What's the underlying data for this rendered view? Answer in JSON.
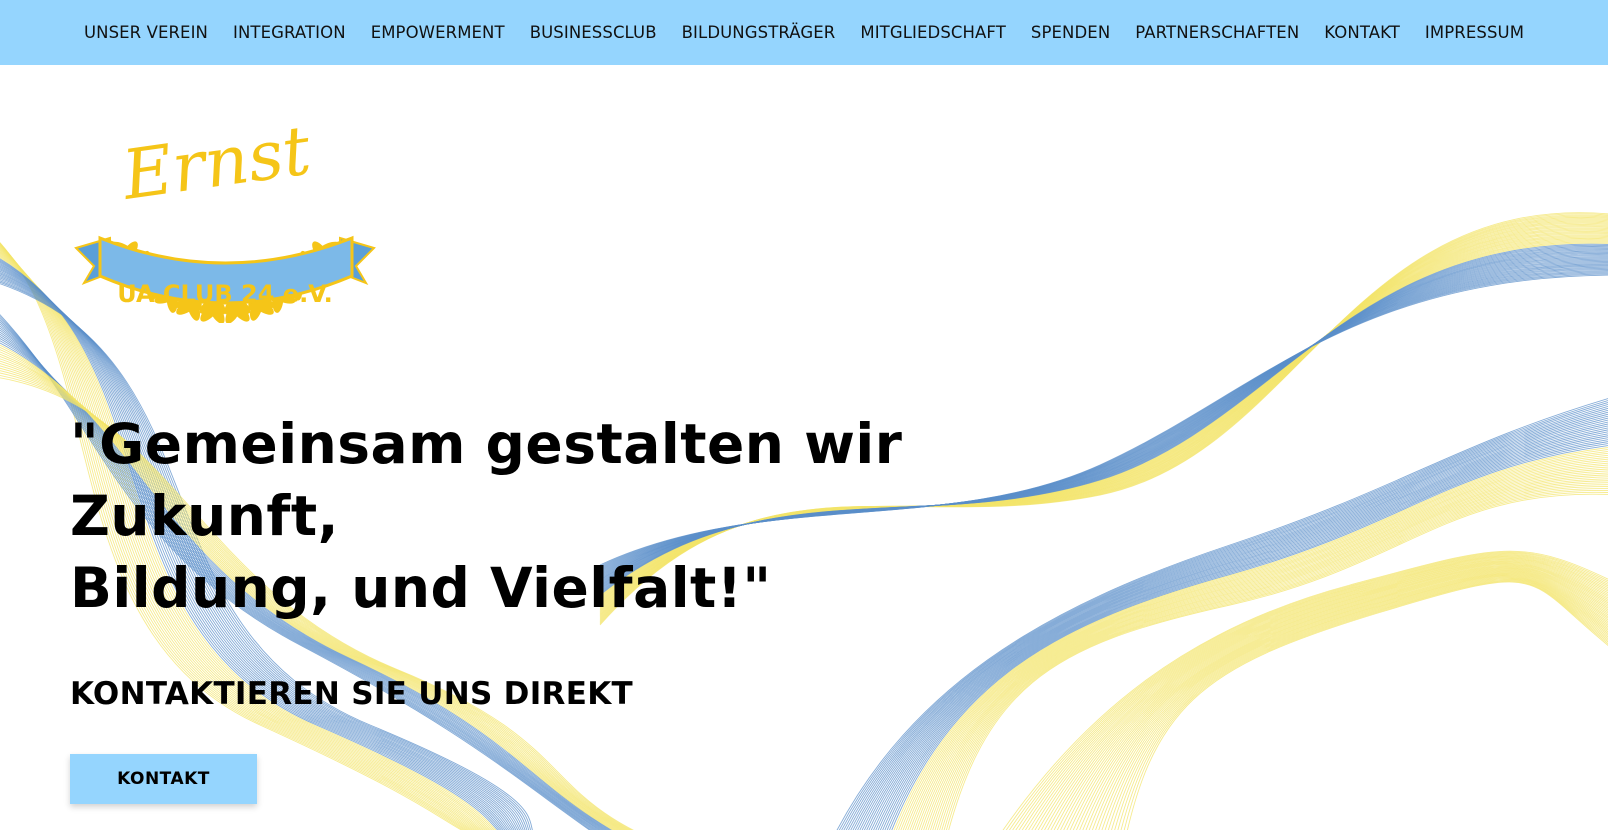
{
  "nav": {
    "items": [
      {
        "label": "UNSER VEREIN"
      },
      {
        "label": "INTEGRATION"
      },
      {
        "label": "EMPOWERMENT"
      },
      {
        "label": "BUSINESSCLUB"
      },
      {
        "label": "BILDUNGSTRÄGER"
      },
      {
        "label": "MITGLIEDSCHAFT"
      },
      {
        "label": "SPENDEN"
      },
      {
        "label": "PARTNERSCHAFTEN"
      },
      {
        "label": "KONTAKT"
      },
      {
        "label": "IMPRESSUM"
      }
    ]
  },
  "logo": {
    "script_text": "Ernst",
    "ribbon_text": "UA CLUB 24 e.V."
  },
  "hero": {
    "headline_line1": "\"Gemeinsam gestalten wir Zukunft,",
    "headline_line2": "Bildung, und Vielfalt!\"",
    "subhead": "KONTAKTIEREN SIE UNS DIREKT",
    "cta_label": "KONTAKT"
  },
  "colors": {
    "nav_bg": "#95d5fe",
    "wave_blue": "#5b8fc9",
    "wave_yellow": "#f3e46a",
    "logo_gold": "#f5c518",
    "logo_ribbon": "#7cb9e8"
  }
}
